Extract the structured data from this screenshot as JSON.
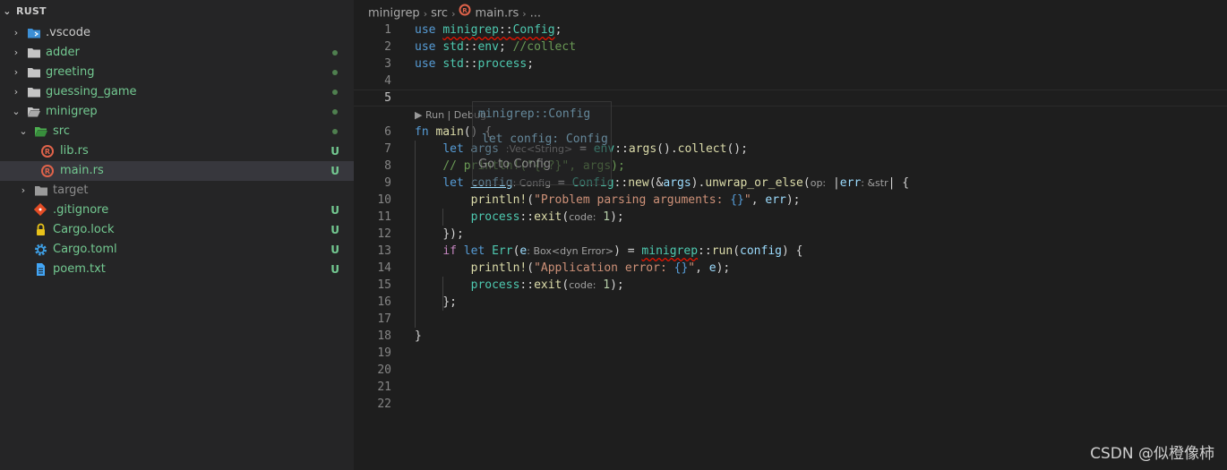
{
  "explorer": {
    "title": "RUST",
    "items": [
      {
        "label": ".vscode",
        "color": "#cccccc",
        "status": ""
      },
      {
        "label": "adder",
        "color": "#73c991",
        "status": ""
      },
      {
        "label": "greeting",
        "color": "#73c991",
        "status": ""
      },
      {
        "label": "guessing_game",
        "color": "#73c991",
        "status": ""
      },
      {
        "label": "minigrep",
        "color": "#73c991",
        "status": ""
      },
      {
        "label": "src",
        "color": "#73c991",
        "status": ""
      },
      {
        "label": "lib.rs",
        "color": "#73c991",
        "status": "U"
      },
      {
        "label": "main.rs",
        "color": "#73c991",
        "status": "U"
      },
      {
        "label": "target",
        "color": "#8c8c8c",
        "status": ""
      },
      {
        "label": ".gitignore",
        "color": "#73c991",
        "status": "U"
      },
      {
        "label": "Cargo.lock",
        "color": "#73c991",
        "status": "U"
      },
      {
        "label": "Cargo.toml",
        "color": "#73c991",
        "status": "U"
      },
      {
        "label": "poem.txt",
        "color": "#73c991",
        "status": "U"
      }
    ]
  },
  "breadcrumb": [
    "minigrep",
    "src",
    "main.rs",
    "..."
  ],
  "code_lens": "Run | Debug",
  "line_numbers": [
    "1",
    "2",
    "3",
    "4",
    "5",
    "6",
    "7",
    "8",
    "9",
    "10",
    "11",
    "12",
    "13",
    "14",
    "15",
    "16",
    "17",
    "18",
    "19",
    "20",
    "21",
    "22"
  ],
  "hover": {
    "line1": "minigrep::Config",
    "line2": "let config: Config",
    "action": "Go to Config"
  },
  "watermark": "CSDN @似橙像柿"
}
